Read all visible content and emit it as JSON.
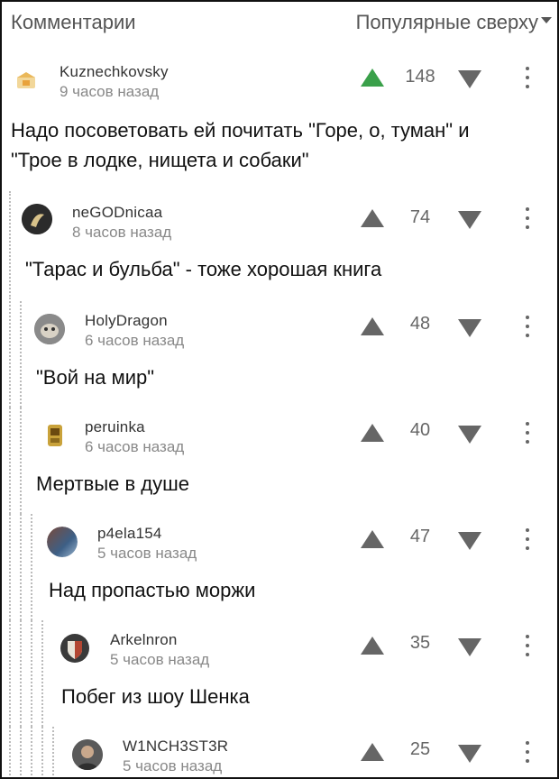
{
  "header": {
    "title": "Комментарии",
    "sort_label": "Популярные сверху"
  },
  "colors": {
    "upvote_active": "#3aa04a",
    "vote_icon": "#666666"
  },
  "comments": [
    {
      "user": "Kuznechkovsky",
      "time": "9 часов назад",
      "score": "148",
      "upvoted": true,
      "text_lines": [
        "Надо посоветовать ей почитать \"Горе, о, туман\" и",
        "\"Трое в лодке, нищета и собаки\""
      ]
    },
    {
      "user": "neGODnicaa",
      "time": "8 часов назад",
      "score": "74",
      "upvoted": false,
      "text_lines": [
        "\"Тарас и бульба\" - тоже хорошая книга"
      ]
    },
    {
      "user": "HolyDragon",
      "time": "6 часов назад",
      "score": "48",
      "upvoted": false,
      "text_lines": [
        "\"Вой на мир\""
      ]
    },
    {
      "user": "peruinka",
      "time": "6 часов назад",
      "score": "40",
      "upvoted": false,
      "text_lines": [
        "Мертвые в душе"
      ]
    },
    {
      "user": "p4ela154",
      "time": "5 часов назад",
      "score": "47",
      "upvoted": false,
      "text_lines": [
        "Над пропастью моржи"
      ]
    },
    {
      "user": "Arkelnron",
      "time": "5 часов назад",
      "score": "35",
      "upvoted": false,
      "text_lines": [
        "Побег из шоу Шенка"
      ]
    },
    {
      "user": "W1NCH3ST3R",
      "time": "5 часов назад",
      "score": "25",
      "upvoted": false,
      "text_lines": []
    }
  ]
}
